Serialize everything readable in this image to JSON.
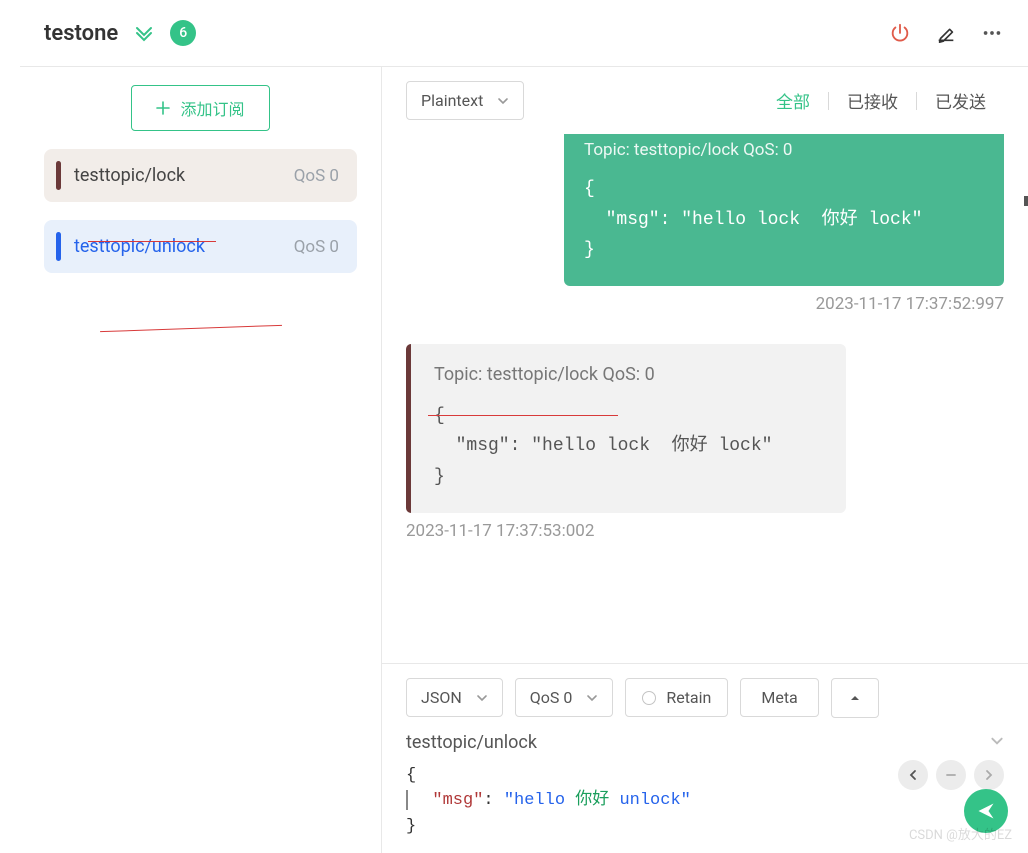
{
  "header": {
    "title": "testone",
    "badge": "6"
  },
  "sidebar": {
    "add_label": "添加订阅",
    "items": [
      {
        "topic": "testtopic/lock",
        "qos": "QoS 0"
      },
      {
        "topic": "testtopic/unlock",
        "qos": "QoS 0"
      }
    ]
  },
  "toolbar": {
    "format": "Plaintext",
    "tabs": {
      "all": "全部",
      "received": "已接收",
      "sent": "已发送"
    }
  },
  "messages": {
    "sent": {
      "meta": "Topic: testtopic/lock   QoS: 0",
      "body": "{\n  \"msg\": \"hello lock  你好 lock\"\n}",
      "time": "2023-11-17 17:37:52:997"
    },
    "recv": {
      "meta": "Topic: testtopic/lock   QoS: 0",
      "body": "{\n  \"msg\": \"hello lock  你好 lock\"\n}",
      "time": "2023-11-17 17:37:53:002"
    }
  },
  "publish": {
    "format": "JSON",
    "qos": "QoS 0",
    "retain": "Retain",
    "meta": "Meta",
    "topic": "testtopic/unlock",
    "payload_parts": {
      "open": "{",
      "key": "\"msg\"",
      "colon": ": ",
      "str1": "\"hello   ",
      "cn": "你好 ",
      "str2": "unlock\"",
      "close": "}"
    }
  },
  "watermark": "CSDN @放大的EZ"
}
